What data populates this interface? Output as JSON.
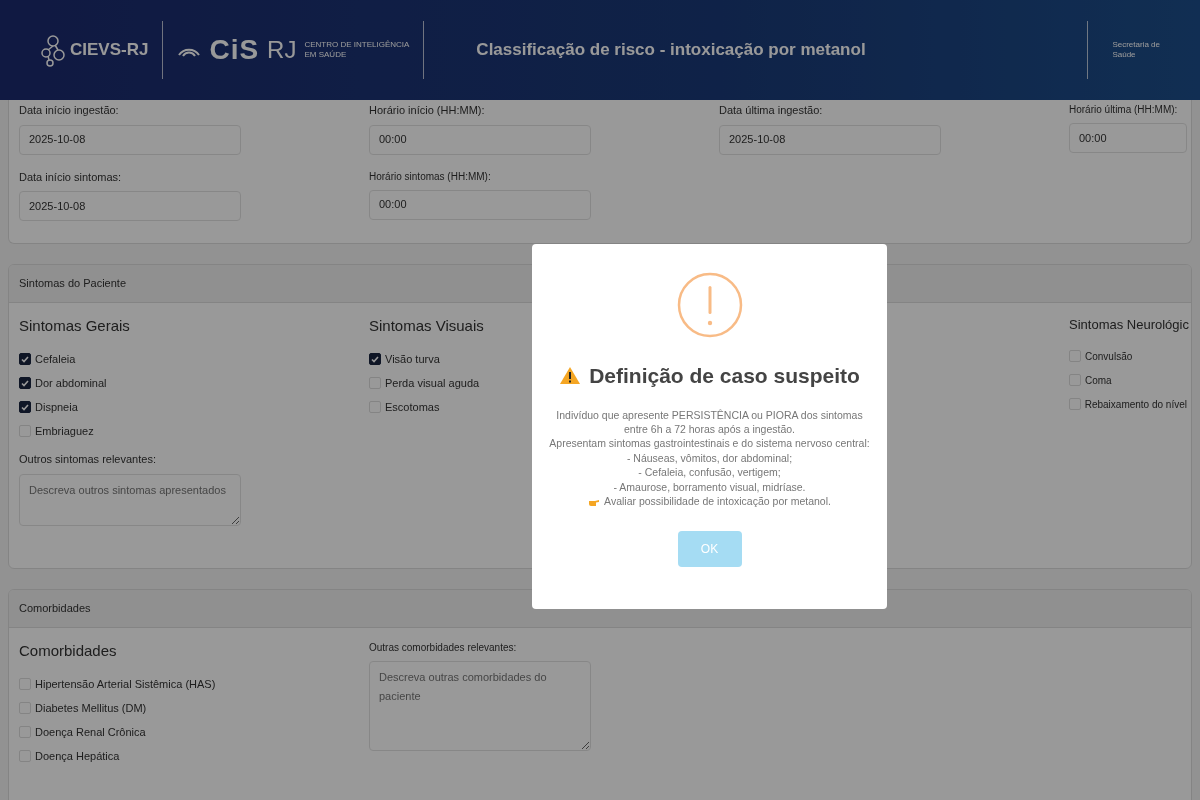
{
  "header": {
    "logo_1": "CIEVS-RJ",
    "logo_2_mark": "CiS",
    "logo_2_suffix": "RJ",
    "logo_2_text_1": "CENTRO DE INTELIGÊNCIA",
    "logo_2_text_2": "EM SAÚDE",
    "title": "Classificação de risco - intoxicação por metanol",
    "right_text_1": "Secretaria de",
    "right_text_2": "Saúde"
  },
  "dates_section": {
    "rows": [
      [
        {
          "label": "Data início ingestão:",
          "value": "2025-10-08"
        },
        {
          "label": "Horário início (HH:MM):",
          "value": "00:00"
        },
        {
          "label": "Data última ingestão:",
          "value": "2025-10-08"
        },
        {
          "label": "Horário última (HH:MM):",
          "value": "00:00"
        }
      ],
      [
        {
          "label": "Data início sintomas:",
          "value": "2025-10-08"
        },
        {
          "label": "Horário sintomas (HH:MM):",
          "value": "00:00"
        }
      ]
    ]
  },
  "symptoms_section": {
    "title": "Sintomas do Paciente",
    "groups": [
      {
        "title": "Sintomas Gerais",
        "items": [
          {
            "label": "Cefaleia",
            "checked": true
          },
          {
            "label": "Dor abdominal",
            "checked": true
          },
          {
            "label": "Dispneia",
            "checked": true
          },
          {
            "label": "Embriaguez",
            "checked": false
          }
        ]
      },
      {
        "title": "Sintomas Visuais",
        "items": [
          {
            "label": "Visão turva",
            "checked": true
          },
          {
            "label": "Perda visual aguda",
            "checked": false
          },
          {
            "label": "Escotomas",
            "checked": false
          }
        ]
      },
      {
        "title": "Sintomas Neurológic",
        "items": [
          {
            "label": "Convulsão",
            "checked": false
          },
          {
            "label": "Coma",
            "checked": false
          },
          {
            "label": "Rebaixamento do nível",
            "checked": false
          }
        ]
      }
    ],
    "other": {
      "label": "Outros sintomas relevantes:",
      "placeholder": "Descreva outros sintomas apresentados"
    }
  },
  "comorbidities_section": {
    "title": "Comorbidades",
    "heading": "Comorbidades",
    "items": [
      {
        "label": "Hipertensão Arterial Sistêmica (HAS)",
        "checked": false
      },
      {
        "label": "Diabetes Mellitus (DM)",
        "checked": false
      },
      {
        "label": "Doença Renal Crônica",
        "checked": false
      },
      {
        "label": "Doença Hepática",
        "checked": false
      }
    ],
    "other": {
      "label": "Outras comorbidades relevantes:",
      "placeholder": "Descreva outras comorbidades do paciente"
    }
  },
  "modal": {
    "title": "Definição de caso suspeito",
    "lines": [
      "Indivíduo que apresente PERSISTÊNCIA ou PIORA dos sintomas entre 6h a 72 horas após a ingestão.",
      "Apresentam sintomas gastrointestinais e do sistema nervoso central:",
      "- Náuseas, vômitos, dor abdominal;",
      "- Cefaleia, confusão, vertigem;",
      "- Amaurose, borramento visual, midríase."
    ],
    "note": "Avaliar possibilidade de intoxicação por metanol.",
    "button": "OK"
  }
}
